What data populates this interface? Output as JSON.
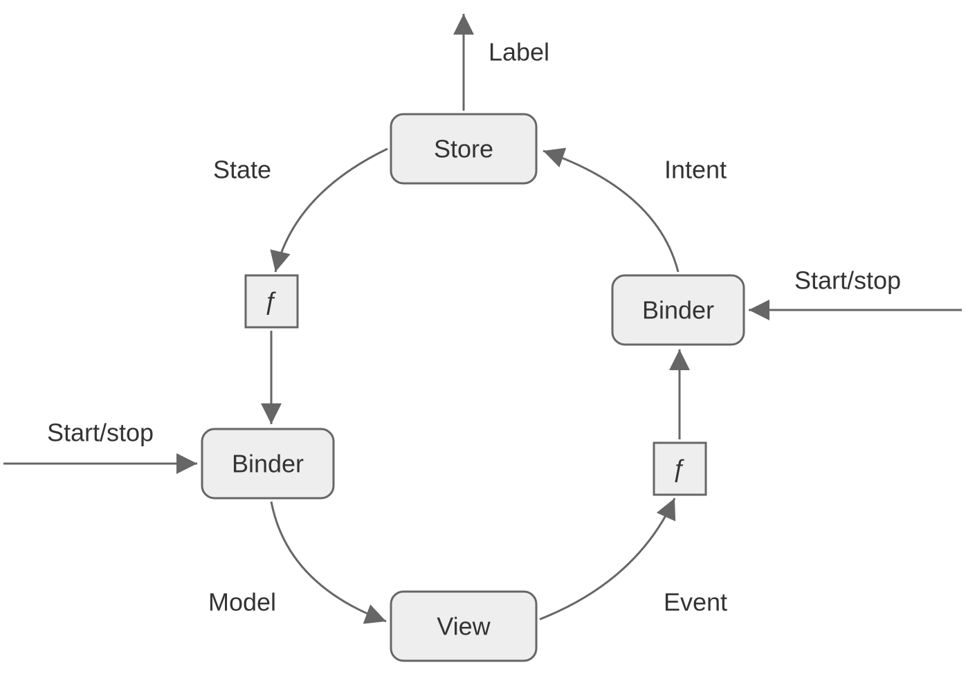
{
  "nodes": {
    "store": "Store",
    "view": "View",
    "binder_left": "Binder",
    "binder_right": "Binder",
    "f_left": "ƒ",
    "f_right": "ƒ"
  },
  "edges": {
    "label": "Label",
    "state": "State",
    "intent": "Intent",
    "model": "Model",
    "event": "Event",
    "start_stop_left": "Start/stop",
    "start_stop_right": "Start/stop"
  }
}
